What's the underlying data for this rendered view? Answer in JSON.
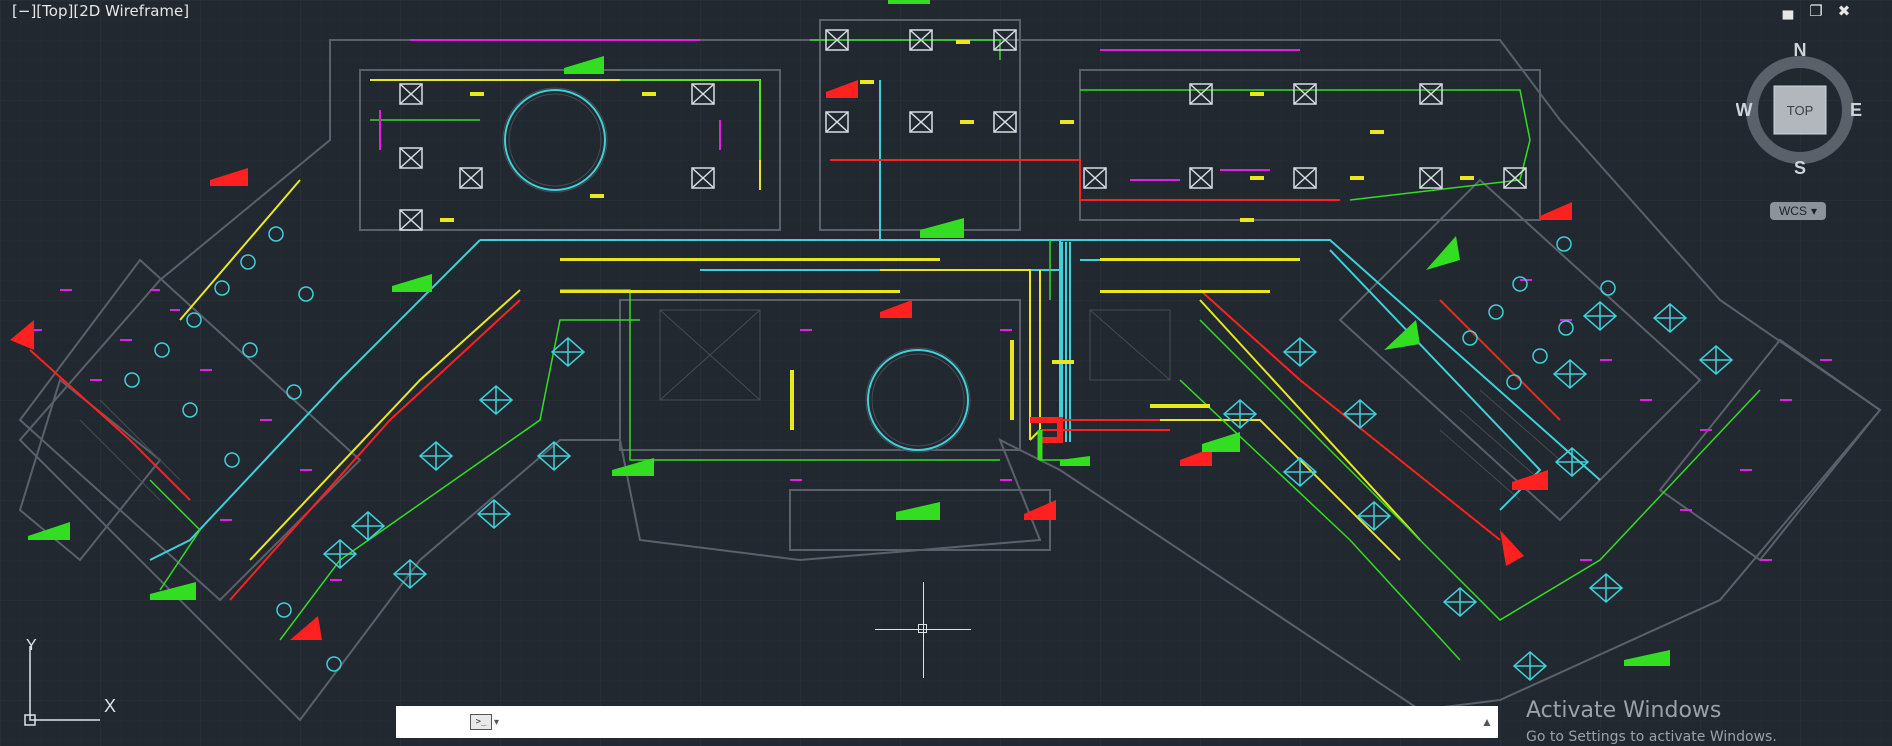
{
  "viewport": {
    "label_parts": [
      "[",
      "−",
      "][",
      "Top",
      "][",
      "2D Wireframe",
      "]"
    ],
    "background": "#212830"
  },
  "window_controls": {
    "minimize": "▄",
    "restore": "❐",
    "close": "✖"
  },
  "viewcube": {
    "face": "TOP",
    "north": "N",
    "south": "S",
    "east": "E",
    "west": "W",
    "wcs_label": "WCS",
    "wcs_caret": "▾"
  },
  "ucs": {
    "x_label": "X",
    "y_label": "Y"
  },
  "command_line": {
    "close_icon": "✕",
    "settings_icon": "🔧",
    "prompt_icon": ">_",
    "value": "",
    "placeholder": "",
    "history_caret": "▲"
  },
  "watermark": {
    "title": "Activate Windows",
    "subtitle": "Go to Settings to activate Windows."
  },
  "colors": {
    "cyan": "#3fd0d8",
    "green": "#33dd22",
    "yellow": "#e8e820",
    "red": "#ff2020",
    "magenta": "#e020e0",
    "white": "#d9dde2",
    "gray_line": "#5a616a"
  }
}
